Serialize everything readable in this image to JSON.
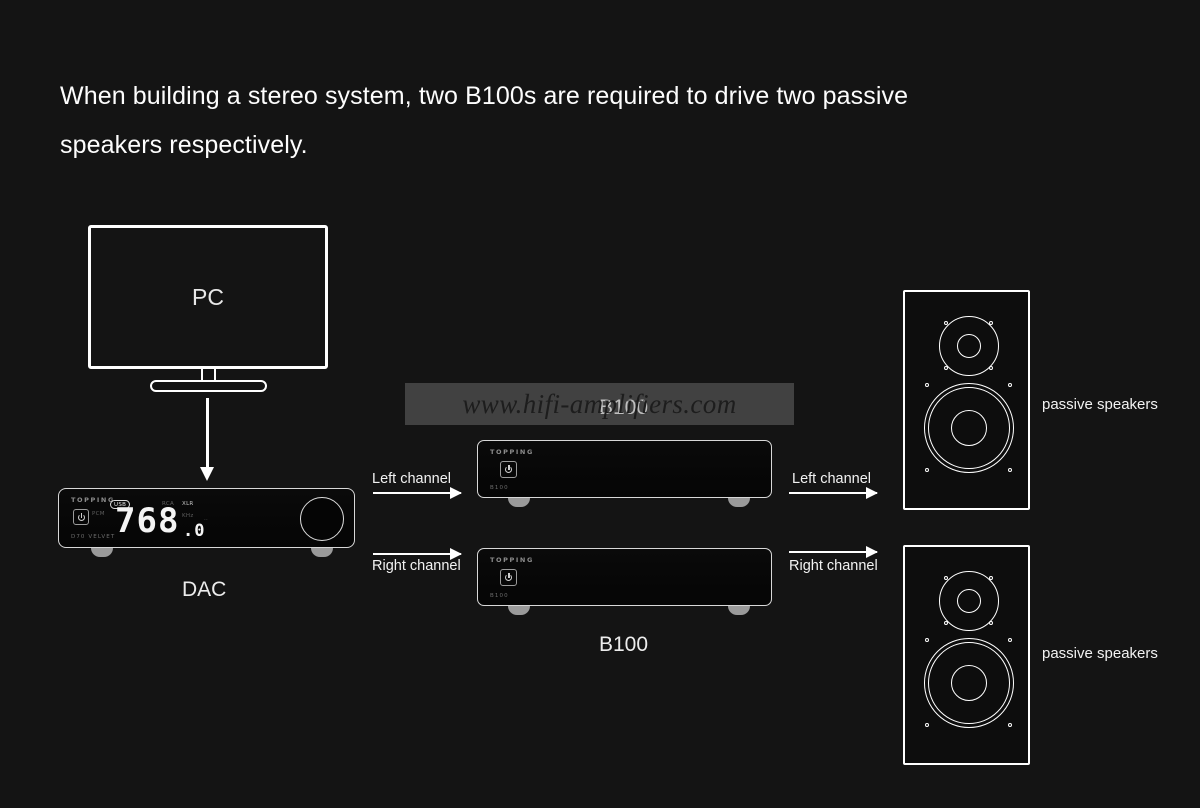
{
  "page": {
    "background_color": "#141414",
    "heading": "When building a stereo system, two B100s are required to drive two passive\nspeakers respectively."
  },
  "watermark": {
    "text": "www.hifi-amplifiers.com"
  },
  "pc": {
    "screen_label": "PC"
  },
  "dac": {
    "caption": "DAC",
    "brand": "TOPPING",
    "model": "D70 VELVET",
    "power_icon": "power-icon",
    "indicators": {
      "usb": "USB",
      "pcm": "PCM",
      "rca": "RCA",
      "xlr": "XLR",
      "khz": "KHz",
      "dots": ".."
    },
    "display": {
      "value": "768",
      "decimal": ".0"
    },
    "knob": "volume-knob"
  },
  "amplifiers": [
    {
      "caption": "B100",
      "brand": "TOPPING",
      "model": "B100",
      "power_icon": "power-icon"
    },
    {
      "caption": "B100",
      "brand": "TOPPING",
      "model": "B100",
      "power_icon": "power-icon"
    }
  ],
  "connections": {
    "pc_to_dac": "arrow-down",
    "dac_to_amp_left": "Left channel",
    "dac_to_amp_right": "Right channel",
    "amp_to_speaker_left": "Left channel",
    "amp_to_speaker_right": "Right channel"
  },
  "speakers": [
    {
      "label": "passive speakers"
    },
    {
      "label": "passive speakers"
    }
  ]
}
